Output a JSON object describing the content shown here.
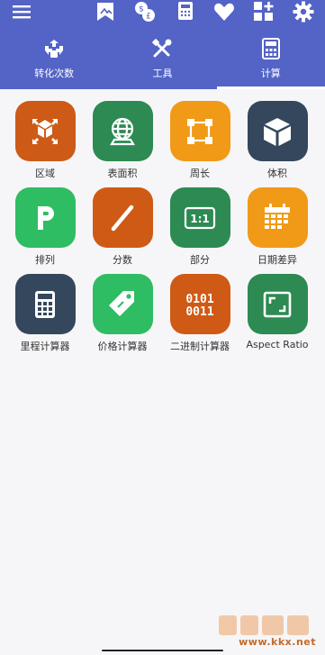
{
  "app": {
    "colors": {
      "header": "#5363c6",
      "background": "#f6f6f8",
      "text": "#333333"
    }
  },
  "topbar": {
    "icons": [
      "menu-icon",
      "bookmark-icon",
      "currency-icon",
      "calculator-icon",
      "favorite-icon",
      "add-widget-icon",
      "gear-icon"
    ]
  },
  "tabs": [
    {
      "label": "转化次数",
      "icon": "convert-icon",
      "active": false
    },
    {
      "label": "工具",
      "icon": "tools-icon",
      "active": false
    },
    {
      "label": "计算",
      "icon": "calculator-icon",
      "active": true
    }
  ],
  "grid": {
    "items": [
      {
        "label": "区域",
        "icon": "area-icon",
        "color": "#cd5a16"
      },
      {
        "label": "表面积",
        "icon": "globe-icon",
        "color": "#2c8a52"
      },
      {
        "label": "周长",
        "icon": "perimeter-icon",
        "color": "#f09a18"
      },
      {
        "label": "体积",
        "icon": "cube-icon",
        "color": "#34475c"
      },
      {
        "label": "排列",
        "icon": "p-icon",
        "color": "#2ebd62"
      },
      {
        "label": "分数",
        "icon": "fraction-icon",
        "color": "#cf5a15"
      },
      {
        "label": "部分",
        "icon": "ratio-icon",
        "color": "#2c8a52"
      },
      {
        "label": "日期差异",
        "icon": "calendar-icon",
        "color": "#f09a18"
      },
      {
        "label": "里程计算器",
        "icon": "mileage-calculator-icon",
        "color": "#34475c"
      },
      {
        "label": "价格计算器",
        "icon": "price-tag-icon",
        "color": "#2ebd62"
      },
      {
        "label": "二进制计算器",
        "icon": "binary-icon",
        "color": "#cf5a15"
      },
      {
        "label": "Aspect Ratio",
        "icon": "aspect-ratio-icon",
        "color": "#2c8a52"
      }
    ]
  },
  "watermark": {
    "text": "www.kkx.net"
  }
}
